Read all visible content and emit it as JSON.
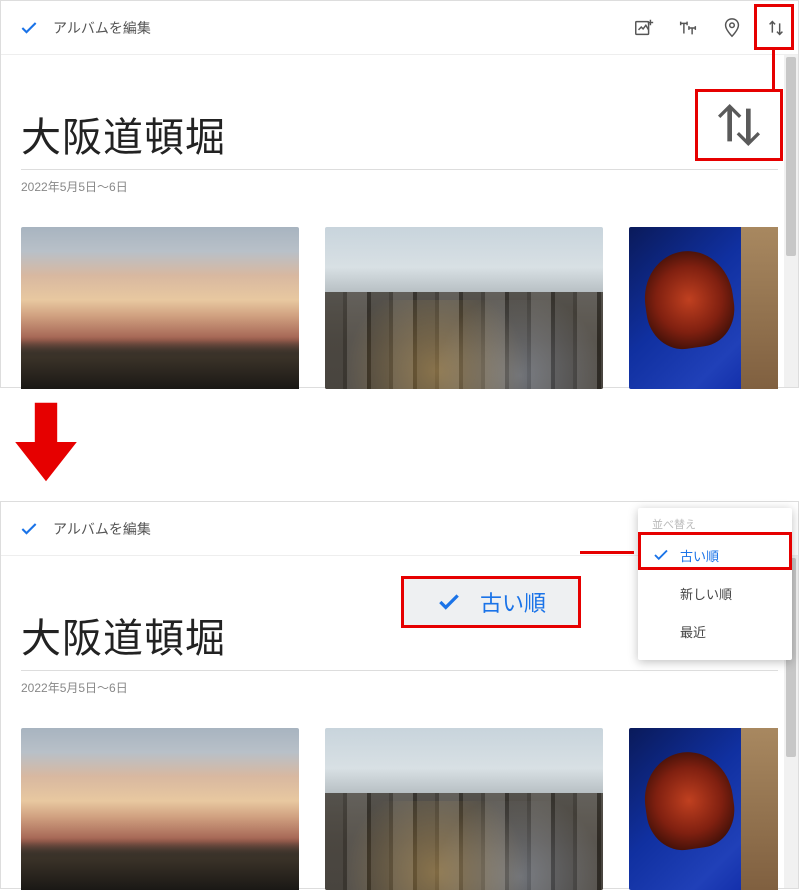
{
  "top_panel": {
    "header": {
      "title": "アルバムを編集"
    },
    "album": {
      "title": "大阪道頓堀",
      "date_range": "2022年5月5日～6日"
    }
  },
  "bottom_panel": {
    "header": {
      "title": "アルバムを編集"
    },
    "album": {
      "title": "大阪道頓堀",
      "date_range": "2022年5月5日～6日"
    },
    "sort_menu": {
      "header": "並べ替え",
      "options": [
        {
          "label": "古い順",
          "selected": true
        },
        {
          "label": "新しい順",
          "selected": false
        },
        {
          "label": "最近",
          "selected": false
        }
      ]
    },
    "zoom_callout_text": "古い順"
  },
  "icons": {
    "add_photo": "add-photo-icon",
    "text": "text-icon",
    "location": "location-icon",
    "sort": "sort-icon"
  }
}
